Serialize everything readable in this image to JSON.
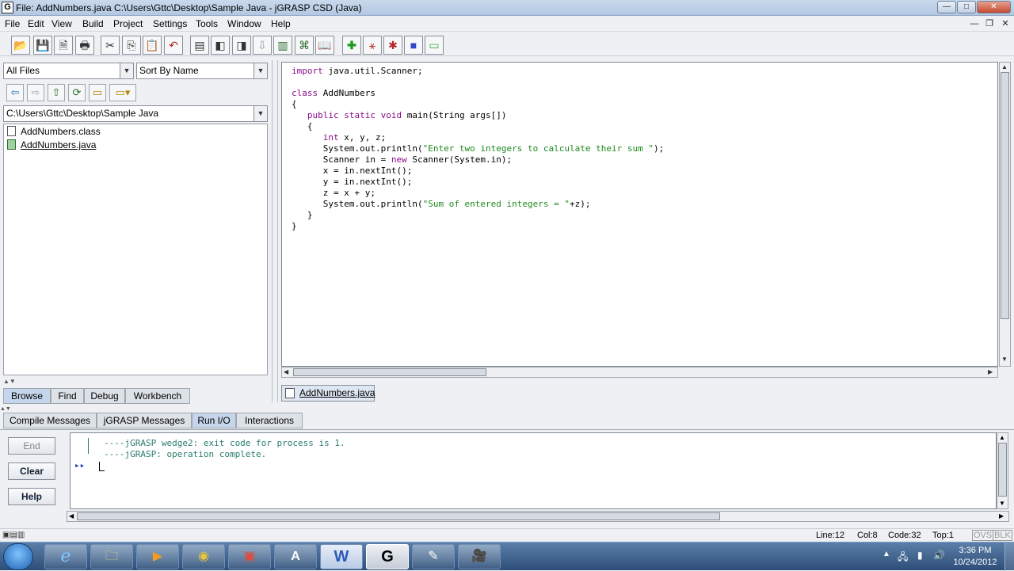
{
  "window": {
    "app_badge": "G",
    "title": "File: AddNumbers.java  C:\\Users\\Gttc\\Desktop\\Sample Java - jGRASP CSD (Java)",
    "min_glyph": "—",
    "max_glyph": "□",
    "close_glyph": "✕"
  },
  "menu": {
    "items": [
      "File",
      "Edit",
      "View",
      "Build",
      "Project",
      "Settings",
      "Tools",
      "Window",
      "Help"
    ],
    "mdi_min": "—",
    "mdi_restore": "❐",
    "mdi_close": "✕"
  },
  "toolbar": {
    "icons": [
      "open-folder-icon",
      "save-icon",
      "save-all-icon",
      "print-icon",
      "cut-icon",
      "copy-icon",
      "paste-icon",
      "undo-icon",
      "page-icon",
      "page-left-icon",
      "page-right-icon",
      "book-icon",
      "pin-icon",
      "chart-icon",
      "tree-icon",
      "book-open-icon",
      "compile-plus-icon",
      "run-icon",
      "debug-bug-icon",
      "blue-square-icon",
      "green-square-icon"
    ],
    "glyphs": [
      "📂",
      "💾",
      "🗎",
      "🖶",
      "✂",
      "⎘",
      "📋",
      "↶",
      "▤",
      "◧",
      "◨",
      "☷",
      "⇩",
      "▥",
      "⌘",
      "📖",
      "✚",
      "⚹",
      "✱",
      "■",
      "▭"
    ],
    "colors": {
      "compile": "#1e9a1e",
      "run": "#c0392b",
      "debug": "#b7282e",
      "blue_square": "#3344cc",
      "green_square": "#38b038"
    }
  },
  "browse": {
    "filter": "All Files",
    "sort": "Sort By Name",
    "path": "C:\\Users\\Gttc\\Desktop\\Sample Java",
    "nav_glyphs": [
      "⇦",
      "⇨",
      "⇧",
      "⟳",
      "▭",
      "▭▾"
    ],
    "files": [
      "AddNumbers.class",
      "AddNumbers.java"
    ],
    "tabs": [
      "Browse",
      "Find",
      "Debug",
      "Workbench"
    ],
    "active_tab": "Browse"
  },
  "editor": {
    "lines": [
      [
        {
          "t": "import",
          "c": "kw"
        },
        {
          "t": " java.util.Scanner;",
          "c": ""
        }
      ],
      [],
      [
        {
          "t": "class",
          "c": "kw"
        },
        {
          "t": " AddNumbers",
          "c": ""
        }
      ],
      [
        {
          "t": "{",
          "c": ""
        }
      ],
      [
        {
          "t": "   ",
          "c": ""
        },
        {
          "t": "public static void",
          "c": "kw"
        },
        {
          "t": " main(String args[])",
          "c": ""
        }
      ],
      [
        {
          "t": "   {",
          "c": ""
        }
      ],
      [
        {
          "t": "      ",
          "c": ""
        },
        {
          "t": "int",
          "c": "kw"
        },
        {
          "t": " x, y, z;",
          "c": ""
        }
      ],
      [
        {
          "t": "      System.out.println(",
          "c": ""
        },
        {
          "t": "\"Enter two integers to calculate their sum \"",
          "c": "st"
        },
        {
          "t": ");",
          "c": ""
        }
      ],
      [
        {
          "t": "      Scanner in = ",
          "c": ""
        },
        {
          "t": "new",
          "c": "kw"
        },
        {
          "t": " Scanner(System.in);",
          "c": ""
        }
      ],
      [
        {
          "t": "      x = in.nextInt();",
          "c": ""
        }
      ],
      [
        {
          "t": "      y = in.nextInt();",
          "c": ""
        }
      ],
      [
        {
          "t": "      z = x + y;",
          "c": ""
        }
      ],
      [
        {
          "t": "      System.out.println(",
          "c": ""
        },
        {
          "t": "\"Sum of entered integers = \"",
          "c": "st"
        },
        {
          "t": "+z);",
          "c": ""
        }
      ],
      [
        {
          "t": "   }",
          "c": ""
        }
      ],
      [
        {
          "t": "}",
          "c": ""
        }
      ]
    ],
    "tab_label": "AddNumbers.java"
  },
  "messages": {
    "tabs": [
      "Compile Messages",
      "jGRASP Messages",
      "Run I/O",
      "Interactions"
    ],
    "active_tab": "Run I/O",
    "buttons": {
      "end": "End",
      "clear": "Clear",
      "help": "Help"
    },
    "output": [
      "----jGRASP wedge2: exit code for process is 1.",
      "----jGRASP: operation complete."
    ],
    "prompt_glyph": "▸▸"
  },
  "status": {
    "line": "Line:12",
    "col": "Col:8",
    "code": "Code:32",
    "top": "Top:1",
    "ovs": "OVS",
    "blk": "BLK"
  },
  "taskbar": {
    "apps": [
      "ie-icon",
      "explorer-folder-icon",
      "media-player-icon",
      "chrome-icon",
      "red-app-icon",
      "autocad-icon",
      "word-icon",
      "jgrasp-icon",
      "notepad-icon",
      "camcorder-icon"
    ],
    "glyphs": [
      "e",
      "🗀",
      "▶",
      "◉",
      "▣",
      "A",
      "W",
      "G",
      "✎",
      "🎥"
    ],
    "time": "3:36 PM",
    "date": "10/24/2012",
    "tray_glyphs": [
      "▲",
      "🖧",
      "▮",
      "🔊"
    ]
  }
}
